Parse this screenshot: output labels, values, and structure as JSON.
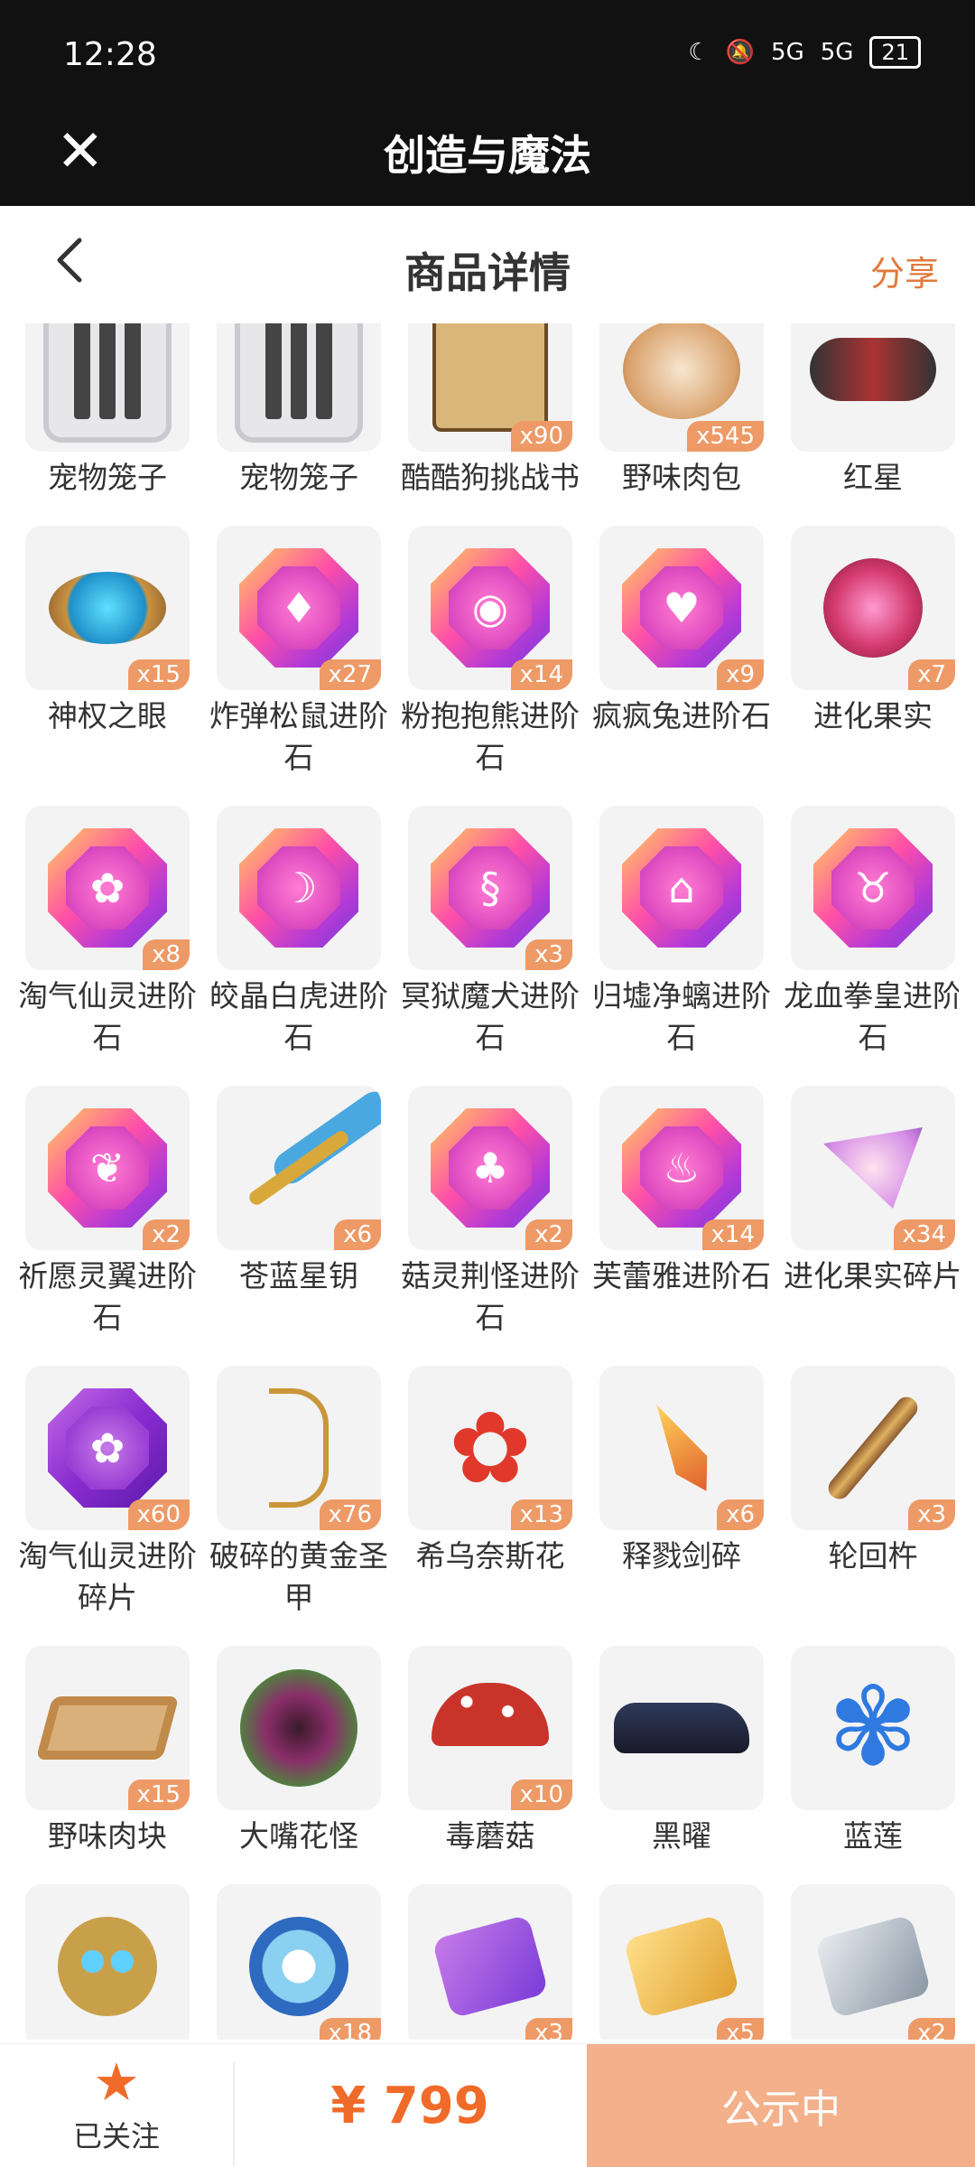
{
  "status_bar": {
    "time": "12:28",
    "signal1": "5G",
    "signal2": "5G",
    "battery": "21"
  },
  "app_header": {
    "title": "创造与魔法"
  },
  "page_header": {
    "title": "商品详情",
    "share_label": "分享"
  },
  "items": [
    {
      "name": "宠物笼子",
      "badge": ""
    },
    {
      "name": "宠物笼子",
      "badge": ""
    },
    {
      "name": "酷酷狗挑战书",
      "badge": "x90"
    },
    {
      "name": "野味肉包",
      "badge": "x545"
    },
    {
      "name": "红星",
      "badge": ""
    },
    {
      "name": "神权之眼",
      "badge": "x15"
    },
    {
      "name": "炸弹松鼠进阶石",
      "badge": "x27"
    },
    {
      "name": "粉抱抱熊进阶石",
      "badge": "x14"
    },
    {
      "name": "疯疯兔进阶石",
      "badge": "x9"
    },
    {
      "name": "进化果实",
      "badge": "x7"
    },
    {
      "name": "淘气仙灵进阶石",
      "badge": "x8"
    },
    {
      "name": "皎晶白虎进阶石",
      "badge": ""
    },
    {
      "name": "冥狱魔犬进阶石",
      "badge": "x3"
    },
    {
      "name": "归墟净螭进阶石",
      "badge": ""
    },
    {
      "name": "龙血拳皇进阶石",
      "badge": ""
    },
    {
      "name": "祈愿灵翼进阶石",
      "badge": "x2"
    },
    {
      "name": "苍蓝星钥",
      "badge": "x6"
    },
    {
      "name": "菇灵荆怪进阶石",
      "badge": "x2"
    },
    {
      "name": "芙蕾雅进阶石",
      "badge": "x14"
    },
    {
      "name": "进化果实碎片",
      "badge": "x34"
    },
    {
      "name": "淘气仙灵进阶碎片",
      "badge": "x60"
    },
    {
      "name": "破碎的黄金圣甲",
      "badge": "x76"
    },
    {
      "name": "希乌奈斯花",
      "badge": "x13"
    },
    {
      "name": "释戮剑碎",
      "badge": "x6"
    },
    {
      "name": "轮回杵",
      "badge": "x3"
    },
    {
      "name": "野味肉块",
      "badge": "x15"
    },
    {
      "name": "大嘴花怪",
      "badge": ""
    },
    {
      "name": "毒蘑菇",
      "badge": "x10"
    },
    {
      "name": "黑曜",
      "badge": ""
    },
    {
      "name": "蓝莲",
      "badge": ""
    },
    {
      "name": "",
      "badge": ""
    },
    {
      "name": "",
      "badge": "x18"
    },
    {
      "name": "",
      "badge": "x3"
    },
    {
      "name": "",
      "badge": "x5"
    },
    {
      "name": "",
      "badge": "x2"
    }
  ],
  "bottom_bar": {
    "follow_label": "已关注",
    "price": "¥ 799",
    "status_label": "公示中"
  }
}
